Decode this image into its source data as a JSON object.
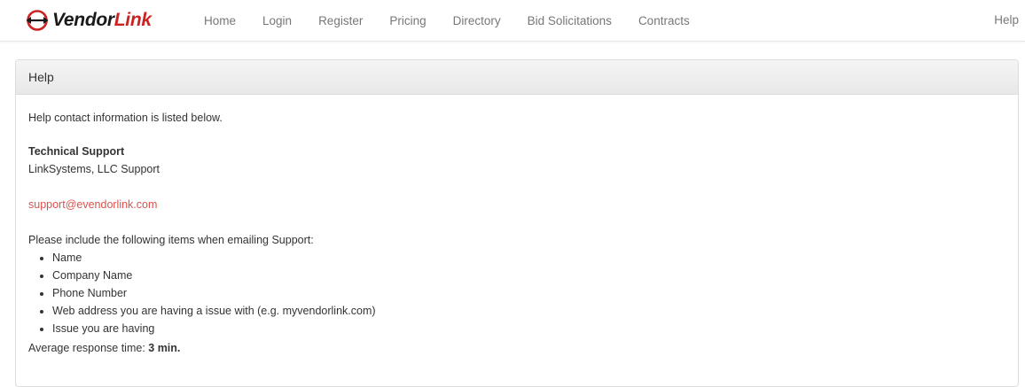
{
  "nav": {
    "brand": {
      "icon": "vendorlink-logo-icon",
      "text_primary": "Vendor",
      "text_accent": "Link",
      "accent_color": "#cc2222"
    },
    "links": [
      "Home",
      "Login",
      "Register",
      "Pricing",
      "Directory",
      "Bid Solicitations",
      "Contracts"
    ],
    "help": "Help"
  },
  "panel": {
    "heading": "Help",
    "intro": "Help contact information is listed below.",
    "support_title": "Technical Support",
    "support_org": "LinkSystems, LLC Support",
    "email": "support@evendorlink.com",
    "email_color": "#d9534f",
    "items_intro": "Please include the following items when emailing Support:",
    "items": [
      "Name",
      "Company Name",
      "Phone Number",
      "Web address you are having a issue with (e.g. myvendorlink.com)",
      "Issue you are having"
    ],
    "response_label": "Average response time: ",
    "response_value": "3 min."
  }
}
